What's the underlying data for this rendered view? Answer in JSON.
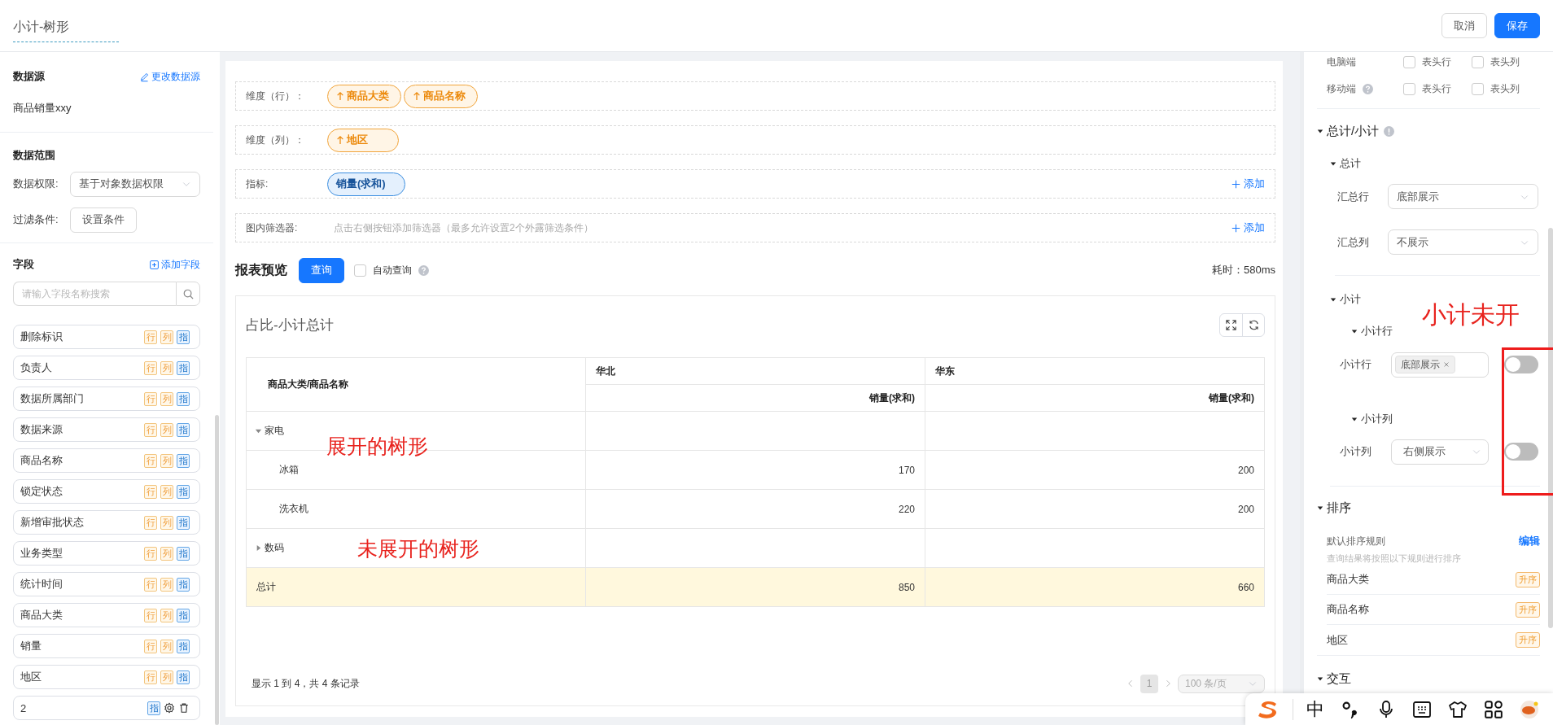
{
  "header": {
    "title": "小计-树形",
    "buttons": [
      {
        "label": "取消",
        "kind": "default"
      },
      {
        "label": "保存",
        "kind": "primary"
      }
    ]
  },
  "left_panel": {
    "data_source": {
      "heading": "数据源",
      "link": "更改数据源",
      "name": "商品销量xxy"
    },
    "data_range": {
      "heading": "数据范围",
      "fields": [
        {
          "label": "数据权限:",
          "kind": "select",
          "value": "基于对象数据权限"
        },
        {
          "label": "过滤条件:",
          "kind": "button",
          "value": "设置条件"
        }
      ]
    },
    "fields": {
      "heading": "字段",
      "link": "添加字段",
      "placeholder": "请输入字段名称搜索",
      "items": [
        {
          "name": "删除标识",
          "kind": "field",
          "tags": [
            {
              "text": "行",
              "kind": "dimension"
            },
            {
              "text": "列",
              "kind": "dimension"
            },
            {
              "text": "指",
              "kind": "measure"
            }
          ]
        },
        {
          "name": "负责人",
          "kind": "field",
          "tags": [
            {
              "text": "行",
              "kind": "dimension"
            },
            {
              "text": "列",
              "kind": "dimension"
            },
            {
              "text": "指",
              "kind": "measure"
            }
          ]
        },
        {
          "name": "数据所属部门",
          "kind": "field",
          "tags": [
            {
              "text": "行",
              "kind": "dimension"
            },
            {
              "text": "列",
              "kind": "dimension"
            },
            {
              "text": "指",
              "kind": "measure"
            }
          ]
        },
        {
          "name": "数据来源",
          "kind": "field",
          "tags": [
            {
              "text": "行",
              "kind": "dimension"
            },
            {
              "text": "列",
              "kind": "dimension"
            },
            {
              "text": "指",
              "kind": "measure"
            }
          ]
        },
        {
          "name": "商品名称",
          "kind": "field",
          "tags": [
            {
              "text": "行",
              "kind": "dimension"
            },
            {
              "text": "列",
              "kind": "dimension"
            },
            {
              "text": "指",
              "kind": "measure"
            }
          ]
        },
        {
          "name": "锁定状态",
          "kind": "field",
          "tags": [
            {
              "text": "行",
              "kind": "dimension"
            },
            {
              "text": "列",
              "kind": "dimension"
            },
            {
              "text": "指",
              "kind": "measure"
            }
          ]
        },
        {
          "name": "新增审批状态",
          "kind": "field",
          "tags": [
            {
              "text": "行",
              "kind": "dimension"
            },
            {
              "text": "列",
              "kind": "dimension"
            },
            {
              "text": "指",
              "kind": "measure"
            }
          ]
        },
        {
          "name": "业务类型",
          "kind": "field",
          "tags": [
            {
              "text": "行",
              "kind": "dimension"
            },
            {
              "text": "列",
              "kind": "dimension"
            },
            {
              "text": "指",
              "kind": "measure"
            }
          ]
        },
        {
          "name": "统计时间",
          "kind": "field",
          "tags": [
            {
              "text": "行",
              "kind": "dimension"
            },
            {
              "text": "列",
              "kind": "dimension"
            },
            {
              "text": "指",
              "kind": "measure"
            }
          ]
        },
        {
          "name": "商品大类",
          "kind": "field",
          "tags": [
            {
              "text": "行",
              "kind": "dimension"
            },
            {
              "text": "列",
              "kind": "dimension"
            },
            {
              "text": "指",
              "kind": "measure"
            }
          ]
        },
        {
          "name": "销量",
          "kind": "field",
          "tags": [
            {
              "text": "行",
              "kind": "dimension"
            },
            {
              "text": "列",
              "kind": "dimension"
            },
            {
              "text": "指",
              "kind": "measure"
            }
          ]
        },
        {
          "name": "地区",
          "kind": "field",
          "tags": [
            {
              "text": "行",
              "kind": "dimension"
            },
            {
              "text": "列",
              "kind": "dimension"
            },
            {
              "text": "指",
              "kind": "measure"
            }
          ]
        },
        {
          "name": "2",
          "kind": "calculated",
          "tags": [
            {
              "text": "指",
              "kind": "measure"
            }
          ]
        }
      ]
    }
  },
  "config_rows": [
    {
      "label": "维度（行）：",
      "pills": [
        {
          "text": "商品大类",
          "kind": "dimension"
        },
        {
          "text": "商品名称",
          "kind": "dimension"
        }
      ]
    },
    {
      "label": "维度（列）：",
      "pills": [
        {
          "text": "地区",
          "kind": "dimension"
        }
      ]
    },
    {
      "label": "指标:",
      "pills": [
        {
          "text": "销量(求和)",
          "kind": "measure"
        }
      ],
      "action": "添加"
    },
    {
      "label": "图内筛选器:",
      "hint": "点击右侧按钮添加筛选器（最多允许设置2个外露筛选条件）",
      "action": "添加"
    }
  ],
  "preview": {
    "title": "报表预览",
    "query_button": "查询",
    "auto_query": {
      "label": "自动查询",
      "checked": false
    },
    "elapsed": "耗时：580ms"
  },
  "report": {
    "title": "占比-小计总计",
    "table": {
      "corner": "商品大类/商品名称",
      "column_groups": [
        "华北",
        "华东"
      ],
      "sub_headers": [
        "销量(求和)",
        "销量(求和)"
      ],
      "rows": [
        {
          "label": "家电",
          "expanded": true,
          "note": "展开的树形",
          "children": [
            {
              "label": "冰箱",
              "values": [
                "170",
                "200"
              ]
            },
            {
              "label": "洗衣机",
              "values": [
                "220",
                "200"
              ]
            }
          ]
        },
        {
          "label": "数码",
          "expanded": false,
          "note": "未展开的树形"
        }
      ],
      "total": {
        "label": "总计",
        "values": [
          "850",
          "660"
        ]
      }
    },
    "pagination": {
      "summary": "显示 1 到 4，共 4 条记录",
      "pages": [
        {
          "label": "1",
          "selected": true
        }
      ],
      "page_size": "100 条/页"
    }
  },
  "right_panel": {
    "freeze": [
      {
        "label": "电脑端",
        "help": false,
        "options": [
          {
            "label": "表头行",
            "checked": false
          },
          {
            "label": "表头列",
            "checked": false
          }
        ]
      },
      {
        "label": "移动端",
        "help": true,
        "options": [
          {
            "label": "表头行",
            "checked": false
          },
          {
            "label": "表头列",
            "checked": false
          }
        ]
      }
    ],
    "totals": {
      "title": "总计/小计",
      "expanded": true,
      "grand": {
        "title": "总计",
        "expanded": true,
        "fields": [
          {
            "label": "汇总行",
            "value": "底部展示"
          },
          {
            "label": "汇总列",
            "value": "不展示"
          }
        ]
      },
      "subtotal": {
        "title": "小计",
        "expanded": true,
        "note": "小计未开",
        "groups": [
          {
            "title": "小计行",
            "expanded": true,
            "label": "小计行",
            "kind": "tags",
            "value": "底部展示",
            "on": false
          },
          {
            "title": "小计列",
            "expanded": true,
            "label": "小计列",
            "kind": "select",
            "value": "右侧展示",
            "on": false
          }
        ]
      }
    },
    "sort": {
      "title": "排序",
      "expanded": true,
      "heading": "默认排序规则",
      "link": "编辑",
      "hint": "查询结果将按照以下规则进行排序",
      "items": [
        {
          "name": "商品大类",
          "order": "升序"
        },
        {
          "name": "商品名称",
          "order": "升序"
        },
        {
          "name": "地区",
          "order": "升序"
        }
      ]
    },
    "interaction": {
      "title": "交互",
      "expanded": true
    }
  },
  "ime_toolbar": {
    "items": [
      {
        "kind": "logo"
      },
      {
        "kind": "text",
        "text": "中"
      },
      {
        "kind": "punctuation"
      },
      {
        "kind": "microphone"
      },
      {
        "kind": "keyboard"
      },
      {
        "kind": "shirt"
      },
      {
        "kind": "grid"
      },
      {
        "kind": "avatar"
      }
    ]
  }
}
